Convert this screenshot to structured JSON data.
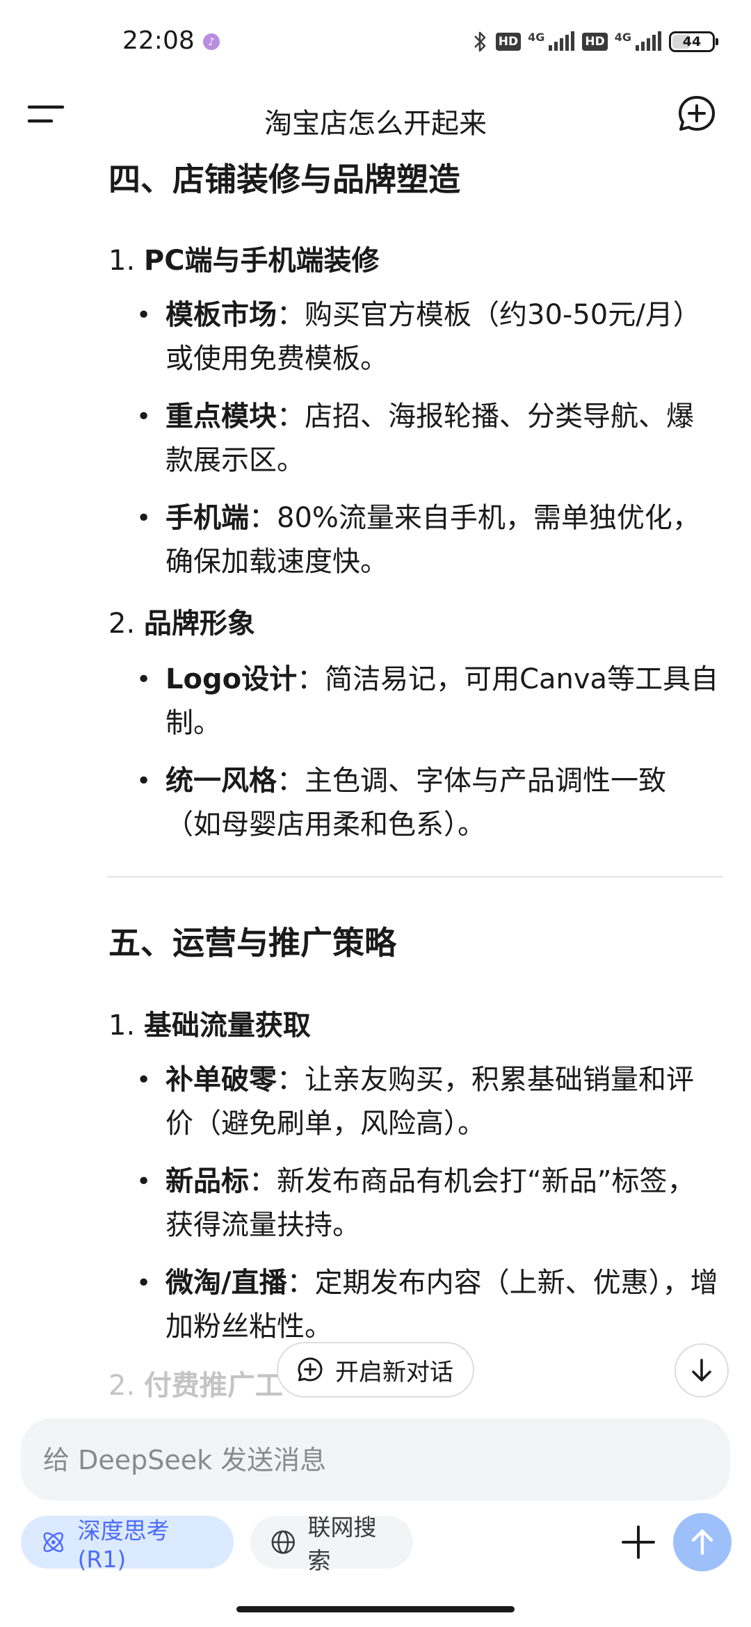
{
  "status_bar": {
    "time": "22:08",
    "app_indicator": "♪",
    "hd1": "HD",
    "net1": "4G",
    "hd2": "HD",
    "net2": "4G",
    "battery": "44",
    "battery_level": 0.44
  },
  "header": {
    "title": "淘宝店怎么开起来"
  },
  "content": {
    "section4": {
      "title": "四、店铺装修与品牌塑造",
      "items": [
        {
          "num": "1.",
          "label": "PC端与手机端装修",
          "bullets": [
            {
              "bold": "模板市场",
              "text": "：购买官方模板（约30-50元/月）或使用免费模板。"
            },
            {
              "bold": "重点模块",
              "text": "：店招、海报轮播、分类导航、爆款展示区。"
            },
            {
              "bold": "手机端",
              "text": "：80%流量来自手机，需单独优化，确保加载速度快。"
            }
          ]
        },
        {
          "num": "2.",
          "label": "品牌形象",
          "bullets": [
            {
              "bold": "Logo设计",
              "text": "：简洁易记，可用Canva等工具自制。"
            },
            {
              "bold": "统一风格",
              "text": "：主色调、字体与产品调性一致（如母婴店用柔和色系）。"
            }
          ]
        }
      ]
    },
    "section5": {
      "title": "五、运营与推广策略",
      "items": [
        {
          "num": "1.",
          "label": "基础流量获取",
          "bullets": [
            {
              "bold": "补单破零",
              "text": "：让亲友购买，积累基础销量和评价（避免刷单，风险高）。"
            },
            {
              "bold": "新品标",
              "text": "：新发布商品有机会打“新品”标签，获得流量扶持。"
            },
            {
              "bold": "微淘/直播",
              "text": "：定期发布内容（上新、优惠），增加粉丝粘性。"
            }
          ]
        },
        {
          "num": "2.",
          "label": "付费推广工"
        }
      ]
    }
  },
  "floating": {
    "new_chat_label": "开启新对话"
  },
  "input": {
    "placeholder": "给 DeepSeek 发送消息",
    "value": ""
  },
  "toolbar": {
    "deep_think_label": "深度思考 (R1)",
    "web_search_label": "联网搜索"
  },
  "colors": {
    "accent": "#4d6bfe",
    "deep_think_bg": "#dbeafe",
    "send_disabled": "#9ec0fa"
  }
}
